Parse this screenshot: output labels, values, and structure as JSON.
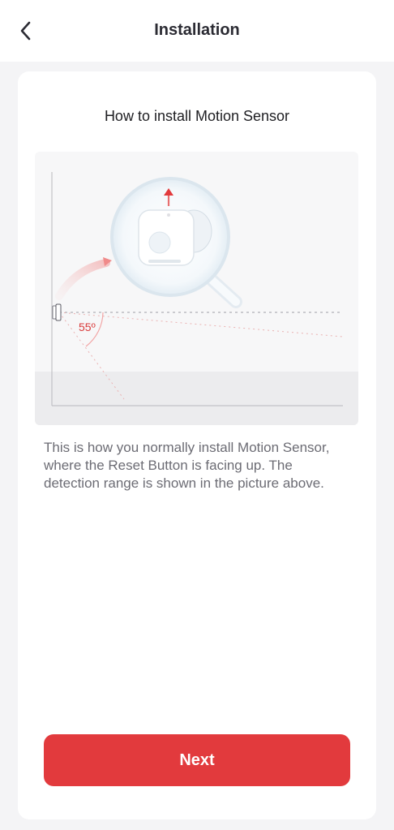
{
  "header": {
    "title": "Installation",
    "back_icon": "chevron-left-icon"
  },
  "card": {
    "title": "How to install Motion Sensor",
    "illustration": {
      "angle_label": "55º",
      "accent_color": "#e23a3d"
    },
    "description": "This is how you normally install Motion Sensor, where the Reset Button is facing up. The detection range is shown in the picture above.",
    "next_label": "Next"
  },
  "colors": {
    "primary": "#e23a3d",
    "background": "#f4f4f6",
    "text_dark": "#1e1e22",
    "text_muted": "#6c6c74"
  }
}
